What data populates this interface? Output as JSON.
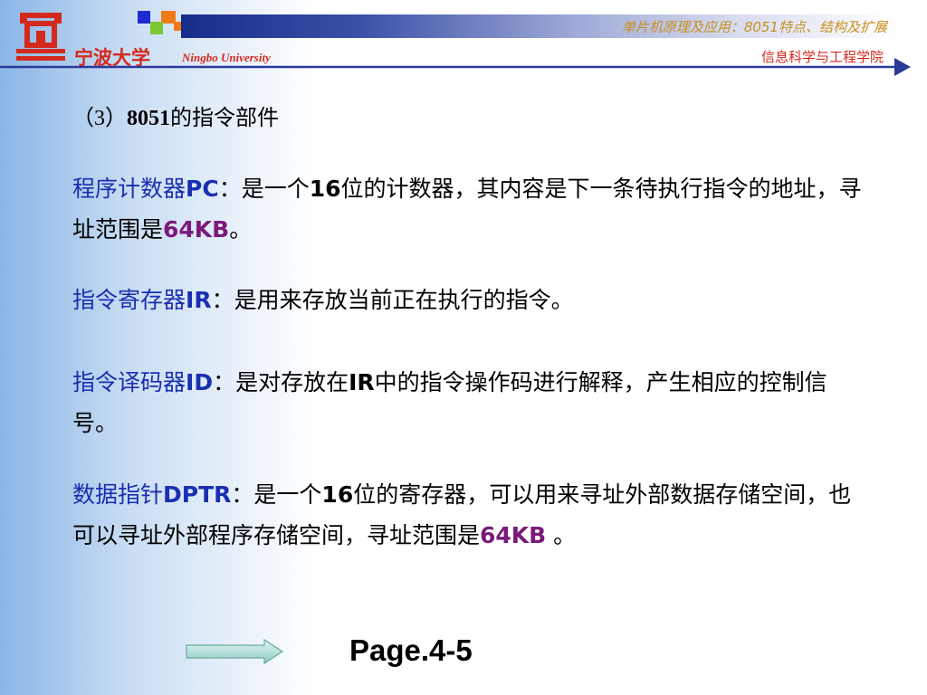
{
  "header": {
    "university_cn": "宁波大学",
    "university_en": "Ningbo University",
    "course_title": "单片机原理及应用：8051特点、结构及扩展",
    "school": "信息科学与工程学院"
  },
  "section_title": {
    "prefix": "（3）",
    "number": "8051",
    "text": "的指令部件"
  },
  "paragraphs": {
    "pc": {
      "term": "程序计数器",
      "abbr": "PC",
      "p1": "：是一个",
      "n1": "16",
      "p2": "位的计数器，其内容是下一条待执行指令的地址，寻址范围是",
      "hl": "64KB",
      "p3": "。"
    },
    "ir": {
      "term": "指令寄存器",
      "abbr": "IR",
      "p1": "：是用来存放当前正在执行的指令。"
    },
    "id": {
      "term": "指令译码器",
      "abbr": "ID",
      "p1": "：是对存放在",
      "n1": "IR",
      "p2": "中的指令操作码进行解释，产生相应的控制信号。"
    },
    "dptr": {
      "term": "数据指针",
      "abbr": "DPTR",
      "p1": "：是一个",
      "n1": "16",
      "p2": "位的寄存器，可以用来寻址外部数据存储空间，也可以寻址外部程序存储空间，寻址范围是",
      "hl": "64KB",
      "p3": " 。"
    }
  },
  "footer": {
    "page": "Page.4-5"
  },
  "colors": {
    "term_blue": "#1a2fb0",
    "highlight_purple": "#7a1a7a",
    "logo_red": "#d42a1e",
    "title_gold": "#c8901c"
  }
}
